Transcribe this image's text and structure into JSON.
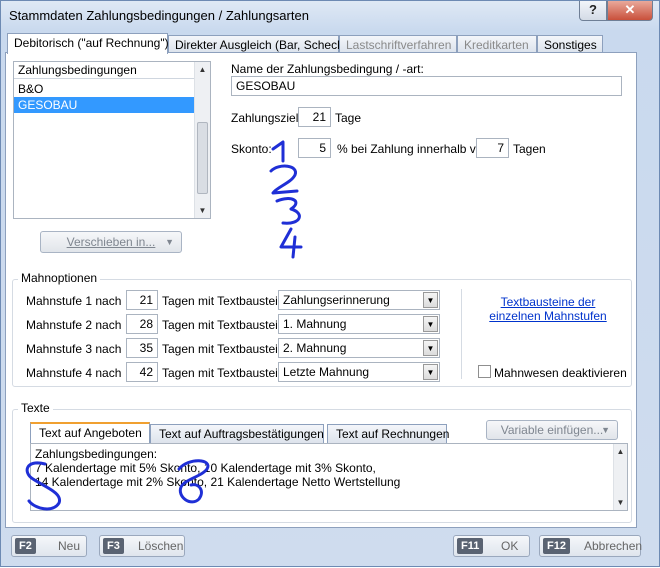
{
  "window": {
    "title": "Stammdaten Zahlungsbedingungen / Zahlungsarten",
    "help_label": "?",
    "close_label": "✕"
  },
  "tabs": [
    {
      "label": "Debitorisch (\"auf Rechnung\")",
      "state": "active"
    },
    {
      "label": "Direkter Ausgleich (Bar, Scheck)",
      "state": "normal"
    },
    {
      "label": "Lastschriftverfahren",
      "state": "disabled"
    },
    {
      "label": "Kreditkarten",
      "state": "disabled"
    },
    {
      "label": "Sonstiges",
      "state": "normal"
    }
  ],
  "list": {
    "header": "Zahlungsbedingungen",
    "items": [
      {
        "label": "B&O",
        "selected": false
      },
      {
        "label": "GESOBAU",
        "selected": true
      }
    ]
  },
  "move_button": {
    "label": "Verschieben in..."
  },
  "condition": {
    "name_label": "Name der Zahlungsbedingung / -art:",
    "name_value": "GESOBAU",
    "ziel_label": "Zahlungsziel:",
    "ziel_value": "21",
    "ziel_unit": "Tage",
    "skonto_label": "Skonto:",
    "skonto_value": "5",
    "skonto_mid": "% bei Zahlung innerhalb von",
    "skonto_days": "7",
    "skonto_unit": "Tagen"
  },
  "mahn": {
    "title": "Mahnoptionen",
    "rows": [
      {
        "label": "Mahnstufe 1 nach",
        "days": "21",
        "mid": "Tagen mit Textbaustein",
        "text": "Zahlungserinnerung"
      },
      {
        "label": "Mahnstufe 2 nach",
        "days": "28",
        "mid": "Tagen mit Textbaustein",
        "text": "1. Mahnung"
      },
      {
        "label": "Mahnstufe 3 nach",
        "days": "35",
        "mid": "Tagen mit Textbaustein",
        "text": "2. Mahnung"
      },
      {
        "label": "Mahnstufe 4 nach",
        "days": "42",
        "mid": "Tagen mit Textbaustein",
        "text": "Letzte Mahnung"
      }
    ],
    "link_line1": "Textbausteine der",
    "link_line2": "einzelnen Mahnstufen",
    "deactivate_label": "Mahnwesen deaktivieren",
    "deactivate_checked": false
  },
  "texte": {
    "title": "Texte",
    "tabs": [
      {
        "label": "Text auf Angeboten",
        "active": true
      },
      {
        "label": "Text auf Auftragsbestätigungen",
        "active": false
      },
      {
        "label": "Text auf Rechnungen",
        "active": false
      }
    ],
    "variable_button": "Variable einfügen...",
    "lines": [
      "Zahlungsbedingungen:",
      "7 Kalendertage mit 5% Skonto, 10 Kalendertage mit 3% Skonto,",
      "14 Kalendertage mit 2% Skonto, 21 Kalendertage Netto Wertstellung"
    ]
  },
  "footer": {
    "new": {
      "key": "F2",
      "label": "Neu"
    },
    "delete": {
      "key": "F3",
      "label": "Löschen"
    },
    "ok": {
      "key": "F11",
      "label": "OK"
    },
    "cancel": {
      "key": "F12",
      "label": "Abbrechen"
    }
  },
  "annotation": {
    "color": "#1f2fd6",
    "digits": [
      "1",
      "2",
      "3",
      "4"
    ]
  }
}
